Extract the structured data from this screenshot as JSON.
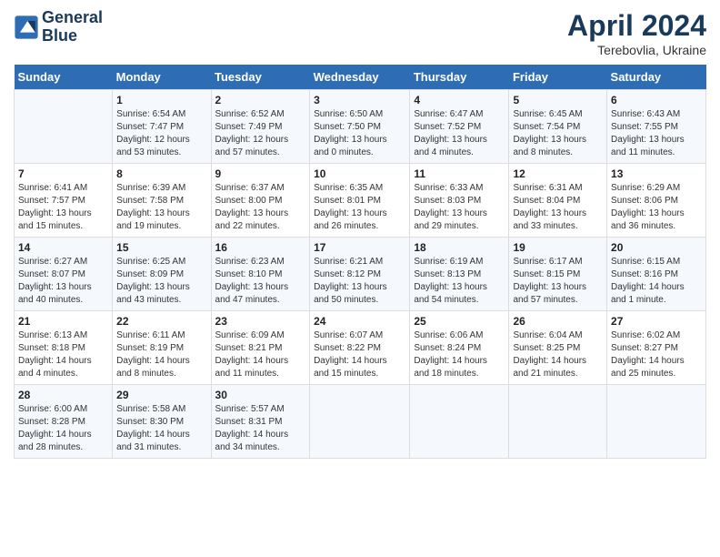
{
  "header": {
    "logo_line1": "General",
    "logo_line2": "Blue",
    "title": "April 2024",
    "subtitle": "Terebovlia, Ukraine"
  },
  "columns": [
    "Sunday",
    "Monday",
    "Tuesday",
    "Wednesday",
    "Thursday",
    "Friday",
    "Saturday"
  ],
  "weeks": [
    [
      {
        "day": "",
        "info": ""
      },
      {
        "day": "1",
        "info": "Sunrise: 6:54 AM\nSunset: 7:47 PM\nDaylight: 12 hours\nand 53 minutes."
      },
      {
        "day": "2",
        "info": "Sunrise: 6:52 AM\nSunset: 7:49 PM\nDaylight: 12 hours\nand 57 minutes."
      },
      {
        "day": "3",
        "info": "Sunrise: 6:50 AM\nSunset: 7:50 PM\nDaylight: 13 hours\nand 0 minutes."
      },
      {
        "day": "4",
        "info": "Sunrise: 6:47 AM\nSunset: 7:52 PM\nDaylight: 13 hours\nand 4 minutes."
      },
      {
        "day": "5",
        "info": "Sunrise: 6:45 AM\nSunset: 7:54 PM\nDaylight: 13 hours\nand 8 minutes."
      },
      {
        "day": "6",
        "info": "Sunrise: 6:43 AM\nSunset: 7:55 PM\nDaylight: 13 hours\nand 11 minutes."
      }
    ],
    [
      {
        "day": "7",
        "info": "Sunrise: 6:41 AM\nSunset: 7:57 PM\nDaylight: 13 hours\nand 15 minutes."
      },
      {
        "day": "8",
        "info": "Sunrise: 6:39 AM\nSunset: 7:58 PM\nDaylight: 13 hours\nand 19 minutes."
      },
      {
        "day": "9",
        "info": "Sunrise: 6:37 AM\nSunset: 8:00 PM\nDaylight: 13 hours\nand 22 minutes."
      },
      {
        "day": "10",
        "info": "Sunrise: 6:35 AM\nSunset: 8:01 PM\nDaylight: 13 hours\nand 26 minutes."
      },
      {
        "day": "11",
        "info": "Sunrise: 6:33 AM\nSunset: 8:03 PM\nDaylight: 13 hours\nand 29 minutes."
      },
      {
        "day": "12",
        "info": "Sunrise: 6:31 AM\nSunset: 8:04 PM\nDaylight: 13 hours\nand 33 minutes."
      },
      {
        "day": "13",
        "info": "Sunrise: 6:29 AM\nSunset: 8:06 PM\nDaylight: 13 hours\nand 36 minutes."
      }
    ],
    [
      {
        "day": "14",
        "info": "Sunrise: 6:27 AM\nSunset: 8:07 PM\nDaylight: 13 hours\nand 40 minutes."
      },
      {
        "day": "15",
        "info": "Sunrise: 6:25 AM\nSunset: 8:09 PM\nDaylight: 13 hours\nand 43 minutes."
      },
      {
        "day": "16",
        "info": "Sunrise: 6:23 AM\nSunset: 8:10 PM\nDaylight: 13 hours\nand 47 minutes."
      },
      {
        "day": "17",
        "info": "Sunrise: 6:21 AM\nSunset: 8:12 PM\nDaylight: 13 hours\nand 50 minutes."
      },
      {
        "day": "18",
        "info": "Sunrise: 6:19 AM\nSunset: 8:13 PM\nDaylight: 13 hours\nand 54 minutes."
      },
      {
        "day": "19",
        "info": "Sunrise: 6:17 AM\nSunset: 8:15 PM\nDaylight: 13 hours\nand 57 minutes."
      },
      {
        "day": "20",
        "info": "Sunrise: 6:15 AM\nSunset: 8:16 PM\nDaylight: 14 hours\nand 1 minute."
      }
    ],
    [
      {
        "day": "21",
        "info": "Sunrise: 6:13 AM\nSunset: 8:18 PM\nDaylight: 14 hours\nand 4 minutes."
      },
      {
        "day": "22",
        "info": "Sunrise: 6:11 AM\nSunset: 8:19 PM\nDaylight: 14 hours\nand 8 minutes."
      },
      {
        "day": "23",
        "info": "Sunrise: 6:09 AM\nSunset: 8:21 PM\nDaylight: 14 hours\nand 11 minutes."
      },
      {
        "day": "24",
        "info": "Sunrise: 6:07 AM\nSunset: 8:22 PM\nDaylight: 14 hours\nand 15 minutes."
      },
      {
        "day": "25",
        "info": "Sunrise: 6:06 AM\nSunset: 8:24 PM\nDaylight: 14 hours\nand 18 minutes."
      },
      {
        "day": "26",
        "info": "Sunrise: 6:04 AM\nSunset: 8:25 PM\nDaylight: 14 hours\nand 21 minutes."
      },
      {
        "day": "27",
        "info": "Sunrise: 6:02 AM\nSunset: 8:27 PM\nDaylight: 14 hours\nand 25 minutes."
      }
    ],
    [
      {
        "day": "28",
        "info": "Sunrise: 6:00 AM\nSunset: 8:28 PM\nDaylight: 14 hours\nand 28 minutes."
      },
      {
        "day": "29",
        "info": "Sunrise: 5:58 AM\nSunset: 8:30 PM\nDaylight: 14 hours\nand 31 minutes."
      },
      {
        "day": "30",
        "info": "Sunrise: 5:57 AM\nSunset: 8:31 PM\nDaylight: 14 hours\nand 34 minutes."
      },
      {
        "day": "",
        "info": ""
      },
      {
        "day": "",
        "info": ""
      },
      {
        "day": "",
        "info": ""
      },
      {
        "day": "",
        "info": ""
      }
    ]
  ]
}
